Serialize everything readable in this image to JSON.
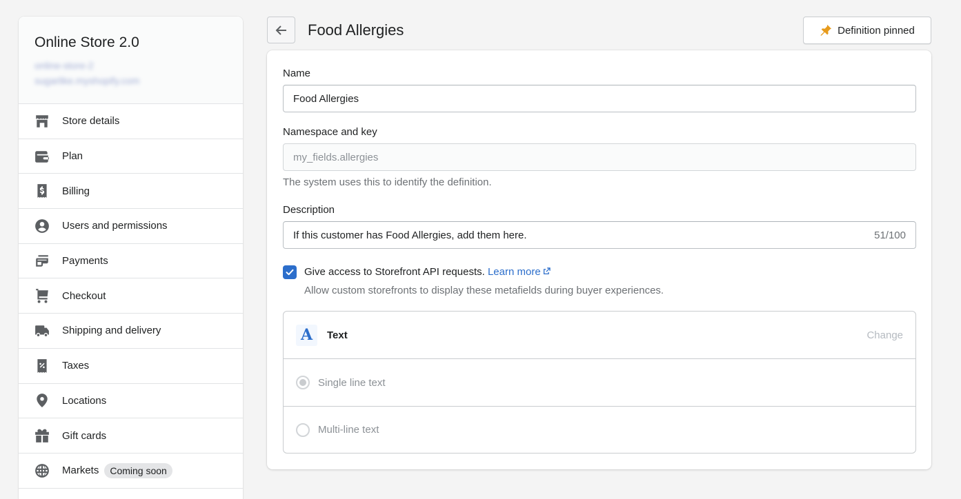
{
  "sidebar": {
    "store_name": "Online Store 2.0",
    "store_blurred_line1": "online-store-2",
    "store_blurred_line2": "sugarlike.myshopify.com",
    "items": [
      {
        "label": "Store details",
        "icon": "store-icon"
      },
      {
        "label": "Plan",
        "icon": "wallet-icon"
      },
      {
        "label": "Billing",
        "icon": "receipt-dollar-icon"
      },
      {
        "label": "Users and permissions",
        "icon": "user-circle-icon"
      },
      {
        "label": "Payments",
        "icon": "payments-icon"
      },
      {
        "label": "Checkout",
        "icon": "cart-icon"
      },
      {
        "label": "Shipping and delivery",
        "icon": "truck-icon"
      },
      {
        "label": "Taxes",
        "icon": "receipt-percent-icon"
      },
      {
        "label": "Locations",
        "icon": "location-pin-icon"
      },
      {
        "label": "Gift cards",
        "icon": "gift-icon"
      },
      {
        "label": "Markets",
        "icon": "globe-icon",
        "badge": "Coming soon"
      }
    ]
  },
  "header": {
    "title": "Food Allergies",
    "back_icon": "arrow-left-icon",
    "pinned_label": "Definition pinned",
    "pinned_icon": "pin-icon",
    "pin_color": "#e79b1c"
  },
  "form": {
    "name_label": "Name",
    "name_value": "Food Allergies",
    "namespace_label": "Namespace and key",
    "namespace_value": "my_fields.allergies",
    "namespace_help": "The system uses this to identify the definition.",
    "description_label": "Description",
    "description_value": "If this customer has Food Allergies, add them here.",
    "description_counter": "51/100",
    "storefront_checked": true,
    "storefront_label": "Give access to Storefront API requests.",
    "storefront_link": "Learn more",
    "storefront_help": "Allow custom storefronts to display these metafields during buyer experiences.",
    "accent_color": "#2c6ecb"
  },
  "type": {
    "icon_glyph": "A",
    "name": "Text",
    "change_label": "Change",
    "options": [
      {
        "label": "Single line text",
        "selected": true
      },
      {
        "label": "Multi-line text",
        "selected": false
      }
    ]
  }
}
